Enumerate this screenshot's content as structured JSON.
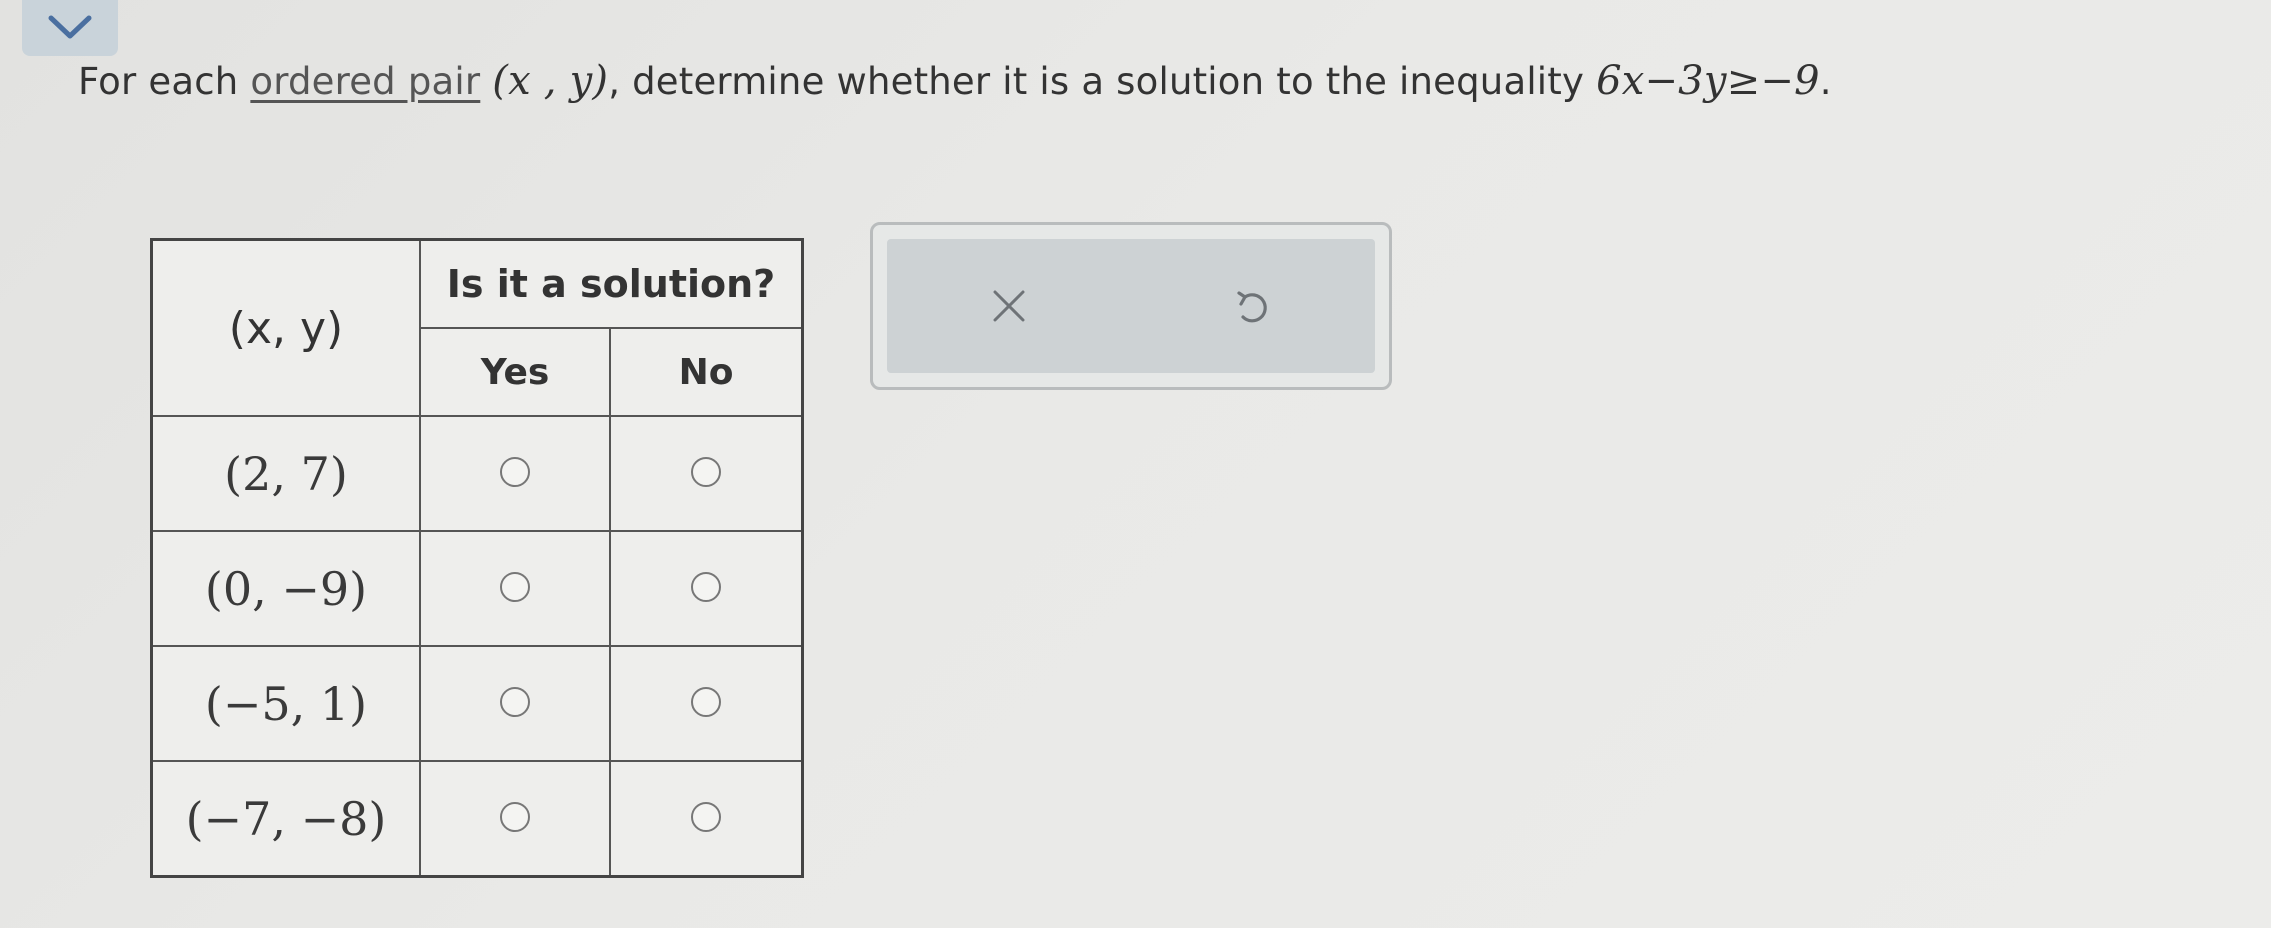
{
  "header": {
    "collapse_icon": "chevron-down-icon",
    "collapse_color": "#c9d3da"
  },
  "question": {
    "prefix": "For each ",
    "link_text": "ordered pair",
    "pair": "(x , y)",
    "middle": ", determine whether it is a solution to the inequality ",
    "inequality": "6x−3y≥−9",
    "suffix": "."
  },
  "table": {
    "xy_header": "(x, y)",
    "solution_header": "Is it a solution?",
    "yes_label": "Yes",
    "no_label": "No",
    "rows": [
      {
        "pair": "(2, 7)",
        "yes_selected": false,
        "no_selected": false
      },
      {
        "pair": "(0, −9)",
        "yes_selected": false,
        "no_selected": false
      },
      {
        "pair": "(−5, 1)",
        "yes_selected": false,
        "no_selected": false
      },
      {
        "pair": "(−7, −8)",
        "yes_selected": false,
        "no_selected": false
      }
    ]
  },
  "actions": {
    "clear_icon": "close-icon",
    "undo_icon": "undo-icon"
  }
}
